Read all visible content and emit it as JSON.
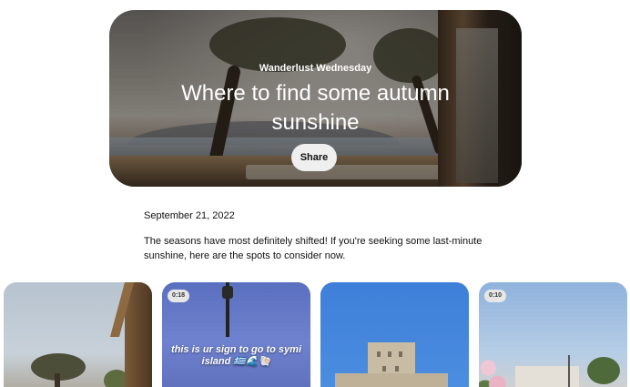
{
  "hero": {
    "kicker": "Wanderlust Wednesday",
    "title": "Where to find some autumn sunshine",
    "share_label": "Share"
  },
  "article": {
    "date": "September 21, 2022",
    "intro": "The seasons have most definitely shifted! If you're seeking some last-minute sunshine, here are the spots to consider now."
  },
  "cards": [
    {
      "badge": ""
    },
    {
      "badge": "0:18",
      "caption": "this is ur sign to go to symi island 🇬🇷🌊🐚"
    },
    {
      "badge": ""
    },
    {
      "badge": "0:10"
    }
  ]
}
